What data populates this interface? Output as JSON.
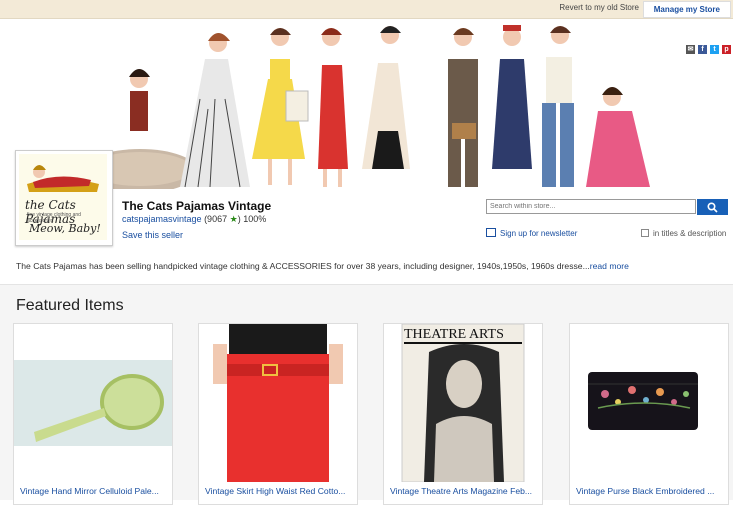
{
  "topbar": {
    "revert": "Revert to my old Store",
    "manage": "Manage my Store"
  },
  "banner": {
    "social": [
      {
        "name": "email-icon",
        "color": "#555555",
        "glyph": "✉"
      },
      {
        "name": "facebook-icon",
        "color": "#3b5998",
        "glyph": "f"
      },
      {
        "name": "twitter-icon",
        "color": "#1da1f2",
        "glyph": "t"
      },
      {
        "name": "pinterest-icon",
        "color": "#cb2027",
        "glyph": "p"
      }
    ]
  },
  "logo": {
    "line1": "the Cats Pajamas",
    "line2": "fine vintage clothing and accessories",
    "line3": "Meow, Baby!"
  },
  "store": {
    "name": "The Cats Pajamas Vintage",
    "username": "catspajamasvintage",
    "feedback": "(9067",
    "feedback_close": ")",
    "percent": "100%",
    "save": "Save this seller"
  },
  "search": {
    "placeholder": "Search within store...",
    "newsletter": "Sign up for newsletter",
    "titles": "in titles & description"
  },
  "description": {
    "text": "The Cats Pajamas has been selling handpicked vintage clothing & ACCESSORIES for over 38 years, including designer, 1940s,1950s, 1960s dresse...",
    "more": "read more"
  },
  "featured": {
    "title": "Featured Items",
    "items": [
      {
        "caption": "Vintage Hand Mirror Celluloid Pale..."
      },
      {
        "caption": "Vintage Skirt High Waist Red Cotto..."
      },
      {
        "caption": "Vintage Theatre Arts Magazine Feb..."
      },
      {
        "caption": "Vintage Purse Black Embroidered ..."
      }
    ]
  },
  "magazine": {
    "masthead": "THEATRE ARTS"
  }
}
